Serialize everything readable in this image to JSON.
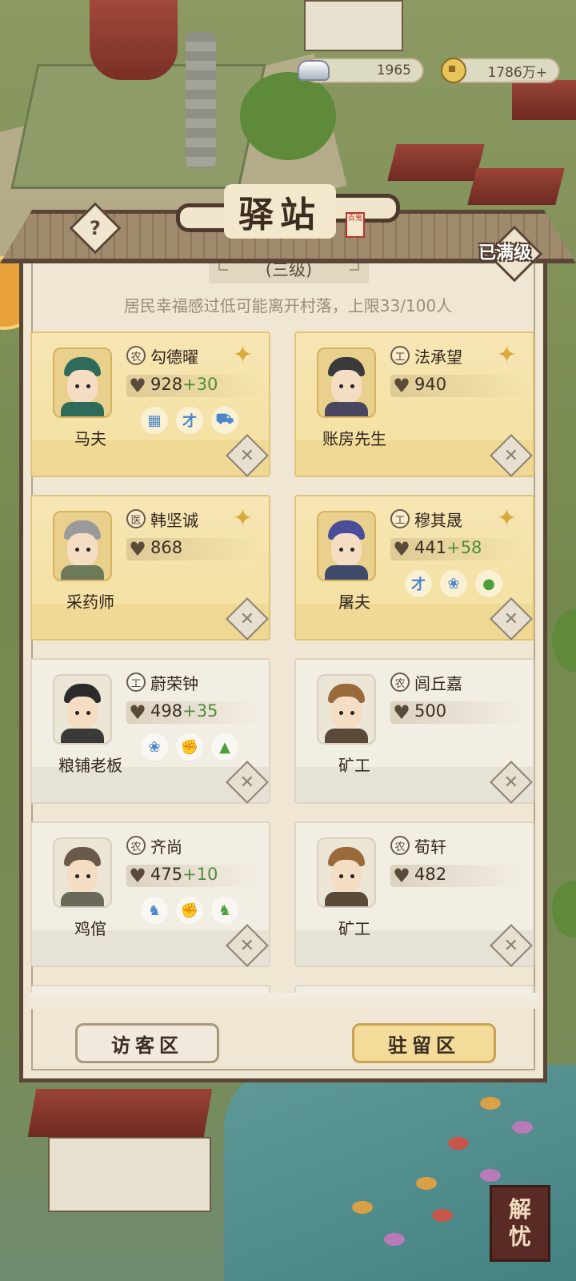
{
  "currency": {
    "silver": "1965",
    "coins": "1786万+"
  },
  "header": {
    "title": "驿站",
    "seal": "百鬼",
    "maxed_label": "已满级",
    "help_label": "?"
  },
  "level": "(三级)",
  "notice": "居民幸福感过低可能离开村落，上限33/100人",
  "residents": [
    {
      "name": "勾德曜",
      "trade": "农",
      "job": "马夫",
      "score": "928",
      "bonus": "+30",
      "tier": "gold",
      "traits": [
        {
          "icon": "building-icon",
          "glyph": "▦",
          "color": "blue"
        },
        {
          "icon": "talent-icon",
          "glyph": "才",
          "color": "blue"
        },
        {
          "icon": "cart-icon",
          "glyph": "⛟",
          "color": "blue"
        }
      ]
    },
    {
      "name": "法承望",
      "trade": "工",
      "job": "账房先生",
      "score": "940",
      "bonus": "",
      "tier": "gold",
      "traits": []
    },
    {
      "name": "韩坚诚",
      "trade": "医",
      "job": "采药师",
      "score": "868",
      "bonus": "",
      "tier": "gold",
      "traits": []
    },
    {
      "name": "穆其晟",
      "trade": "工",
      "job": "屠夫",
      "score": "441",
      "bonus": "+58",
      "tier": "gold",
      "traits": [
        {
          "icon": "talent-icon",
          "glyph": "才",
          "color": "blue"
        },
        {
          "icon": "fish-icon",
          "glyph": "❀",
          "color": "blue"
        },
        {
          "icon": "pouch-icon",
          "glyph": "●",
          "color": "green"
        }
      ]
    },
    {
      "name": "蔚荣钟",
      "trade": "工",
      "job": "粮铺老板",
      "score": "498",
      "bonus": "+35",
      "tier": "plain",
      "traits": [
        {
          "icon": "fish-icon",
          "glyph": "❀",
          "color": "blue"
        },
        {
          "icon": "strength-icon",
          "glyph": "✊",
          "color": "green"
        },
        {
          "icon": "rice-sack-icon",
          "glyph": "▲",
          "color": "green"
        }
      ]
    },
    {
      "name": "闾丘嘉",
      "trade": "农",
      "job": "矿工",
      "score": "500",
      "bonus": "",
      "tier": "plain",
      "traits": []
    },
    {
      "name": "齐尚",
      "trade": "农",
      "job": "鸡倌",
      "score": "475",
      "bonus": "+10",
      "tier": "plain",
      "traits": [
        {
          "icon": "chicken-icon",
          "glyph": "♞",
          "color": "blue"
        },
        {
          "icon": "strength-icon",
          "glyph": "✊",
          "color": "green"
        },
        {
          "icon": "chicken-icon",
          "glyph": "♞",
          "color": "green"
        }
      ]
    },
    {
      "name": "荀轩",
      "trade": "农",
      "job": "矿工",
      "score": "482",
      "bonus": "",
      "tier": "plain",
      "traits": []
    }
  ],
  "buttons": {
    "visitor": "访客区",
    "stay": "驻留区"
  },
  "corner": {
    "line1": "解",
    "line2": "忧"
  },
  "colors": {
    "frame": "#5a4636",
    "gold_card": "#f3df9f",
    "bonus_green": "#4f8e3a"
  }
}
